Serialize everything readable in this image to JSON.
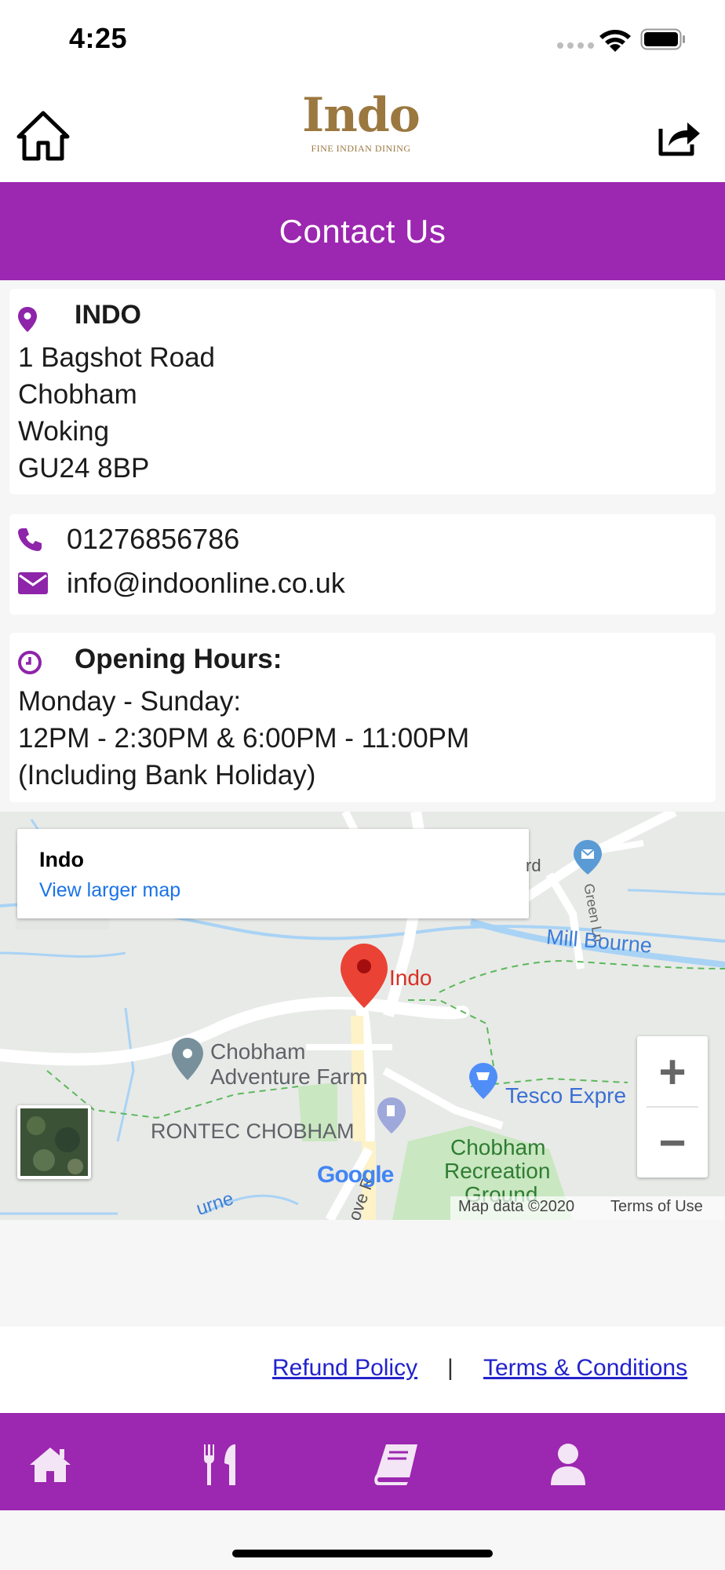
{
  "status_bar": {
    "time": "4:25"
  },
  "header": {
    "logo_text": "Indo",
    "logo_tagline": "FINE INDIAN DINING",
    "home_icon": "home-outline-icon",
    "share_icon": "share-icon"
  },
  "page_title": "Contact Us",
  "address": {
    "name": "INDO",
    "lines": [
      "1 Bagshot Road",
      "Chobham",
      "Woking",
      "GU24 8BP"
    ]
  },
  "contact": {
    "phone": "01276856786",
    "email": "info@indoonline.co.uk"
  },
  "hours": {
    "label": "Opening Hours:",
    "lines": [
      "Monday - Sunday:",
      "12PM - 2:30PM & 6:00PM - 11:00PM",
      "(Including Bank Holiday)"
    ]
  },
  "map": {
    "info_title": "Indo",
    "info_link": "View larger map",
    "zoom_in": "+",
    "zoom_out": "−",
    "labels": {
      "pin": "Indo",
      "road_fragment": "rd",
      "green_ln": "Green Ln",
      "mill_bourne": "Mill Bourne",
      "adventure_farm_1": "Chobham",
      "adventure_farm_2": "Adventure Farm",
      "tesco": "Tesco Expre",
      "rontec": "RONTEC CHOBHAM",
      "recreation_1": "Chobham",
      "recreation_2": "Recreation",
      "recreation_3": "Ground",
      "bourne": "urne",
      "grove": "ove R"
    },
    "attribution": "Map data ©2020",
    "terms": "Terms of Use",
    "google_logo": "Google"
  },
  "links": {
    "refund": "Refund Policy",
    "separator": "|",
    "terms": "Terms & Conditions"
  },
  "tabbar": {
    "icons": [
      "home-icon",
      "utensils-icon",
      "book-icon",
      "user-icon"
    ]
  },
  "colors": {
    "brand": "#9c27b0",
    "logo": "#9b7840",
    "link": "#2222cc"
  }
}
